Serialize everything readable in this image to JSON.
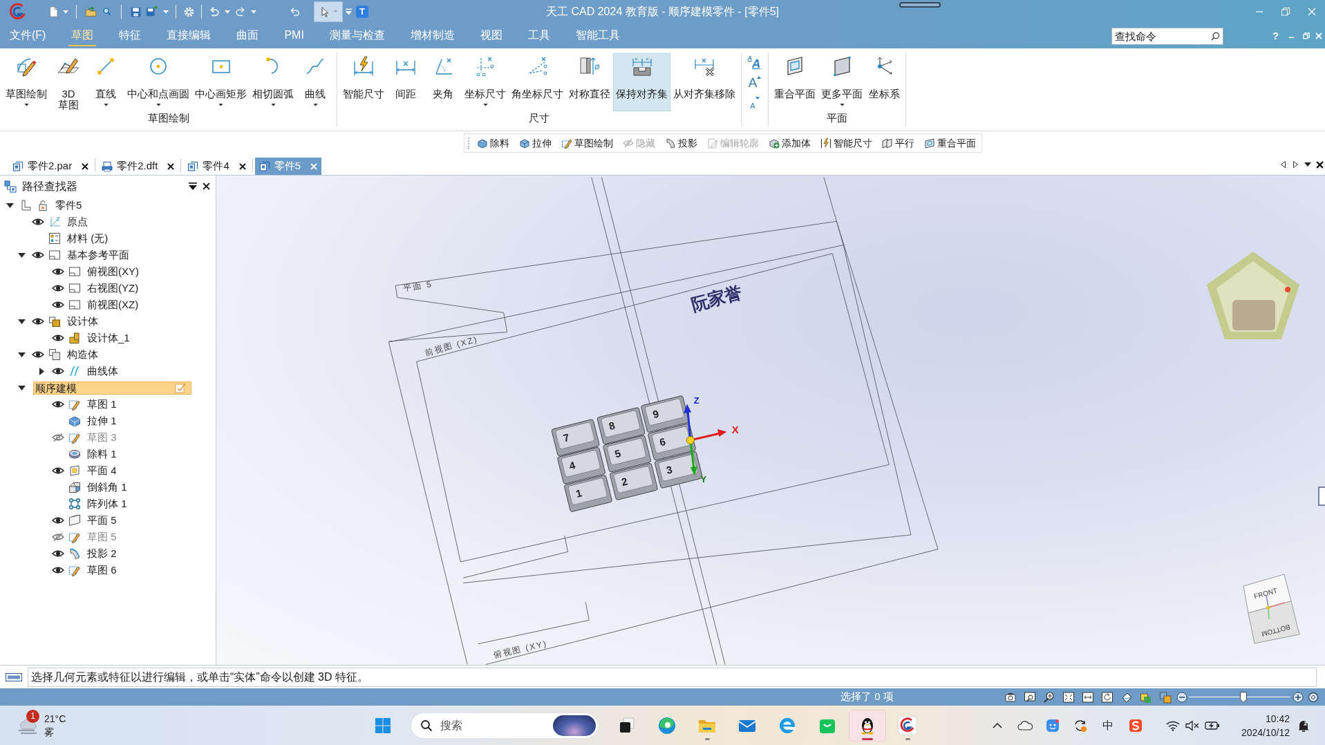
{
  "window": {
    "title": "天工 CAD 2024 教育版 - 顺序建模零件 - [零件5]"
  },
  "quick_access": {
    "select_tool": {
      "selected": true
    },
    "t_button": {
      "label": "T"
    }
  },
  "menu": [
    {
      "label": "文件(F)",
      "selected": false
    },
    {
      "label": "草图",
      "selected": true
    },
    {
      "label": "特征",
      "selected": false
    },
    {
      "label": "直接编辑",
      "selected": false
    },
    {
      "label": "曲面",
      "selected": false
    },
    {
      "label": "PMI",
      "selected": false
    },
    {
      "label": "测量与检查",
      "selected": false
    },
    {
      "label": "增材制造",
      "selected": false
    },
    {
      "label": "视图",
      "selected": false
    },
    {
      "label": "工具",
      "selected": false
    },
    {
      "label": "智能工具",
      "selected": false
    }
  ],
  "command_search": {
    "placeholder": "查找命令"
  },
  "help_button": {
    "label": "?"
  },
  "ribbon": {
    "groups": [
      {
        "kind": "commands",
        "title": "草图绘制",
        "buttons": [
          {
            "label": "草图绘制",
            "dropdown": true,
            "selected": false
          },
          {
            "label": "3D\n草图",
            "selected": false
          },
          {
            "label": "直线",
            "dropdown": true,
            "selected": false
          },
          {
            "label": "中心和点画圆",
            "dropdown": true,
            "selected": false
          },
          {
            "label": "中心画矩形",
            "dropdown": true,
            "selected": false
          },
          {
            "label": "相切圆弧",
            "dropdown": true,
            "selected": false
          },
          {
            "label": "曲线",
            "dropdown": true,
            "selected": false
          }
        ]
      },
      {
        "kind": "commands",
        "title": "尺寸",
        "buttons": [
          {
            "label": "智能尺寸",
            "dropdown": false,
            "selected": false
          },
          {
            "label": "间距",
            "dropdown": false,
            "selected": false
          },
          {
            "label": "夹角",
            "dropdown": false,
            "selected": false
          },
          {
            "label": "坐标尺寸",
            "dropdown": true,
            "selected": false
          },
          {
            "label": "角坐标尺寸",
            "dropdown": false,
            "selected": false
          },
          {
            "label": "对称直径",
            "dropdown": false,
            "selected": false
          },
          {
            "label": "保持对齐集",
            "dropdown": false,
            "selected": true
          },
          {
            "label": "从对齐集移除",
            "dropdown": false,
            "selected": false
          }
        ]
      },
      {
        "kind": "format",
        "buttons": [
          {
            "kind": "style",
            "label": "$^{A}$A"
          },
          {
            "kind": "grow",
            "label": "A"
          },
          {
            "kind": "shrink",
            "label": "A"
          }
        ]
      },
      {
        "kind": "commands",
        "title": "平面",
        "buttons": [
          {
            "label": "重合平面",
            "dropdown": false,
            "selected": false
          },
          {
            "label": "更多平面",
            "dropdown": true,
            "selected": false
          },
          {
            "label": "坐标系",
            "dropdown": false,
            "selected": false
          }
        ]
      }
    ]
  },
  "command_bar": [
    {
      "label": "除料",
      "disabled": false
    },
    {
      "label": "拉伸",
      "disabled": false
    },
    {
      "label": "草图绘制",
      "disabled": false
    },
    {
      "label": "隐藏",
      "disabled": true
    },
    {
      "label": "投影",
      "disabled": false
    },
    {
      "label": "编辑轮廓",
      "disabled": true
    },
    {
      "label": "添加体",
      "disabled": false
    },
    {
      "label": "智能尺寸",
      "disabled": false
    },
    {
      "label": "平行",
      "disabled": false
    },
    {
      "label": "重合平面",
      "disabled": false
    }
  ],
  "document_tabs": [
    {
      "label": "零件2.par",
      "kind": "part",
      "selected": false
    },
    {
      "label": "零件2.dft",
      "kind": "drawing",
      "selected": false
    },
    {
      "label": "零件4",
      "kind": "part",
      "selected": false
    },
    {
      "label": "零件5",
      "kind": "part",
      "selected": true
    }
  ],
  "pathfinder": {
    "title": "路径查找器",
    "tree": [
      {
        "label": "零件5",
        "kind": "part",
        "expanded": true,
        "selected": false,
        "children": [
          {
            "label": "原点",
            "kind": "origin",
            "visible": true,
            "selected": false
          },
          {
            "label": "材料 (无)",
            "kind": "material",
            "selected": false
          },
          {
            "label": "基本参考平面",
            "kind": "plane",
            "visible": true,
            "expanded": true,
            "selected": false,
            "children": [
              {
                "label": "俯视图(XY)",
                "kind": "plane",
                "visible": true,
                "selected": false
              },
              {
                "label": "右视图(YZ)",
                "kind": "plane",
                "visible": true,
                "selected": false
              },
              {
                "label": "前视图(XZ)",
                "kind": "plane",
                "visible": true,
                "selected": false
              }
            ]
          },
          {
            "label": "设计体",
            "kind": "body-group",
            "visible": true,
            "expanded": true,
            "selected": false,
            "children": [
              {
                "label": "设计体_1",
                "kind": "body",
                "visible": true,
                "selected": false
              }
            ]
          },
          {
            "label": "构造体",
            "kind": "construction",
            "visible": true,
            "expanded": true,
            "selected": false,
            "children": [
              {
                "label": "曲线体",
                "kind": "curve-body",
                "visible": true,
                "expanded": false,
                "selected": false
              }
            ]
          },
          {
            "label": "顺序建模",
            "kind": "ordered",
            "expanded": true,
            "selected": true,
            "children": [
              {
                "label": "草图 1",
                "kind": "sketch",
                "visible": true,
                "selected": false
              },
              {
                "label": "拉伸 1",
                "kind": "extrude",
                "selected": false
              },
              {
                "label": "草图 3",
                "kind": "sketch",
                "visible": false,
                "selected": false
              },
              {
                "label": "除料 1",
                "kind": "cut",
                "selected": false
              },
              {
                "label": "平面 4",
                "kind": "ref-plane",
                "visible": true,
                "selected": false
              },
              {
                "label": "倒斜角 1",
                "kind": "chamfer",
                "selected": false
              },
              {
                "label": "阵列体 1",
                "kind": "pattern",
                "selected": false
              },
              {
                "label": "平面 5",
                "kind": "offset-plane",
                "visible": true,
                "selected": false
              },
              {
                "label": "草图 5",
                "kind": "sketch",
                "visible": false,
                "selected": false
              },
              {
                "label": "投影 2",
                "kind": "projection",
                "visible": true,
                "selected": false
              },
              {
                "label": "草图 6",
                "kind": "sketch",
                "visible": true,
                "selected": false
              }
            ]
          }
        ]
      }
    ]
  },
  "viewport": {
    "plane_labels": [
      "平面 5",
      "前视图 (XZ)",
      "俯视图 (XY)"
    ],
    "sketch_text": "阮家誉",
    "keys": [
      "7",
      "8",
      "9",
      "4",
      "5",
      "6",
      "1",
      "2",
      "3"
    ],
    "axes": [
      "X",
      "Z",
      "Y"
    ],
    "view_cube": [
      "FRONT",
      "BOTTOM"
    ]
  },
  "prompt": {
    "text": "选择几何元素或特征以进行编辑，或单击“实体”命令以创建 3D 特征。"
  },
  "status_bar": {
    "selection": "选择了 0 项",
    "zoom": {
      "level": 0.54
    }
  },
  "taskbar": {
    "weather": {
      "badge": "1",
      "temperature": "21°C",
      "condition": "雾"
    },
    "search": {
      "placeholder": "搜索"
    },
    "apps": [
      {
        "kind": "task-view",
        "running": false,
        "active": false
      },
      {
        "kind": "swirl-browser",
        "running": false,
        "active": false
      },
      {
        "kind": "folder",
        "running": true,
        "active": false
      },
      {
        "kind": "mail",
        "running": false,
        "active": false
      },
      {
        "kind": "e-browser",
        "running": false,
        "active": false
      },
      {
        "kind": "green-bag",
        "running": false,
        "active": false
      },
      {
        "kind": "penguin",
        "running": true,
        "active": true
      },
      {
        "kind": "cad",
        "running": true,
        "active": false
      }
    ],
    "tray": {
      "input_method": "中"
    },
    "clock": {
      "time": "10:42",
      "date": "2024/10/12"
    }
  }
}
